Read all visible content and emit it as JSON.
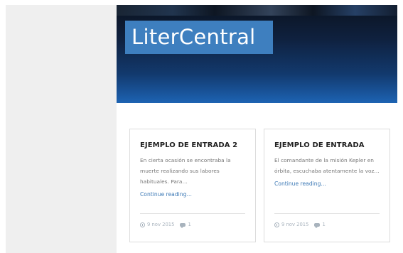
{
  "site": {
    "logo_text": "LiterCentral"
  },
  "posts": [
    {
      "title": "EJEMPLO DE ENTRADA 2",
      "excerpt": "En cierta ocasión se encontraba la muerte realizando sus labores habituales. Para…",
      "more_label": "Continue reading…",
      "date": "9 nov 2015",
      "comments": "1"
    },
    {
      "title": "EJEMPLO DE ENTRADA",
      "excerpt": "El comandante de la misión Kepler en órbita, escuchaba atentamente la voz…",
      "more_label": "Continue reading…",
      "date": "9 nov 2015",
      "comments": "1"
    }
  ],
  "icons": {
    "date": "clock-icon",
    "comments": "comment-icon"
  },
  "colors": {
    "logo_bg": "#3e7fbf",
    "link": "#3b78b5",
    "meta": "#a8b3bd"
  }
}
